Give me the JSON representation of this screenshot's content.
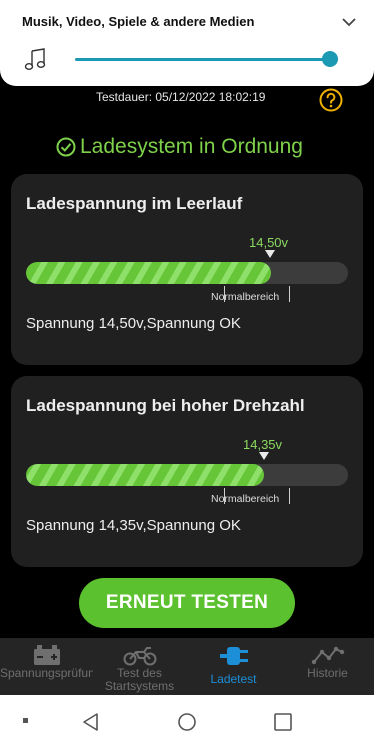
{
  "media_panel": {
    "title": "Musik, Video, Spiele & andere Medien",
    "volume_level": 0.97,
    "accent": "#1c9ab4",
    "icon": "music-note-icon"
  },
  "header": {
    "test_duration": "Testdauer:  05/12/2022 18:02:19",
    "help_icon": "help-circle-icon"
  },
  "status": {
    "text": "Ladesystem in Ordnung",
    "color": "#7ed14b",
    "icon": "check-circle-icon"
  },
  "cards": [
    {
      "title": "Ladespannung im Leerlauf",
      "value_label": "14,50v",
      "fill_fraction": 0.76,
      "normal_range_label": "Normalbereich",
      "result": "Spannung 14,50v,Spannung OK"
    },
    {
      "title": "Ladespannung bei hoher Drehzahl",
      "value_label": "14,35v",
      "fill_fraction": 0.74,
      "normal_range_label": "Normalbereich",
      "result": "Spannung 14,35v,Spannung OK"
    }
  ],
  "retest_button": {
    "label": "ERNEUT TESTEN",
    "color": "#5cc12f"
  },
  "bottom_nav": {
    "active_color": "#1d8fd8",
    "items": [
      {
        "label": "Spannungsprüfung",
        "icon": "battery-icon"
      },
      {
        "label": "Test des Startsystems",
        "icon": "motorcycle-icon"
      },
      {
        "label": "Ladetest",
        "icon": "charging-plug-icon",
        "active": true
      },
      {
        "label": "Historie",
        "icon": "line-chart-icon"
      }
    ]
  },
  "system_nav": {
    "items": [
      "menu-dot-icon",
      "back-icon",
      "home-icon",
      "recents-icon"
    ]
  }
}
